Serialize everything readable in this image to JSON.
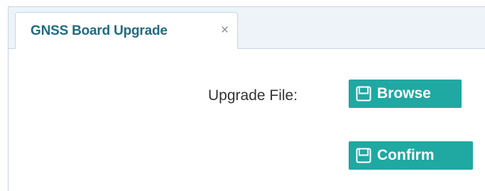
{
  "tab": {
    "title": "GNSS Board Upgrade",
    "close": "×"
  },
  "form": {
    "upgrade_file_label": "Upgrade File:",
    "browse_label": "Browse",
    "confirm_label": "Confirm"
  },
  "icons": {
    "browse_icon": "save-icon",
    "confirm_icon": "save-icon"
  },
  "colors": {
    "button_bg": "#20a8a3",
    "tab_title": "#1f6b81",
    "tabbar_bg": "#eef3fa",
    "border": "#c9d6e2"
  }
}
